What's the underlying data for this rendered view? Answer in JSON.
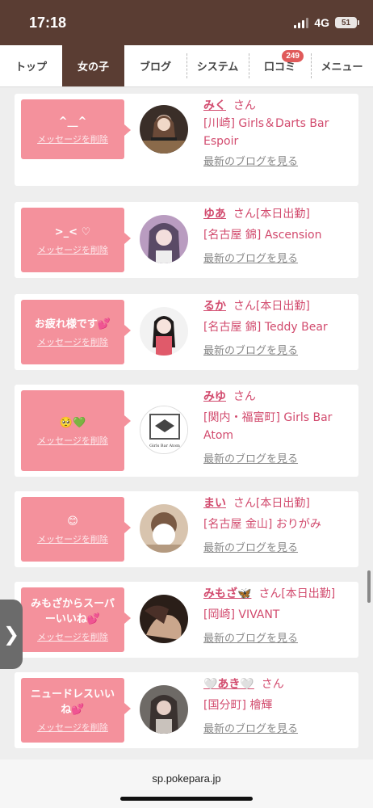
{
  "status_bar": {
    "time": "17:18",
    "network": "4G",
    "battery": "51"
  },
  "nav": {
    "tabs": [
      {
        "label": "トップ",
        "active": false
      },
      {
        "label": "女の子",
        "active": true
      },
      {
        "label": "ブログ",
        "active": false
      },
      {
        "label": "システム",
        "active": false
      },
      {
        "label": "口コミ",
        "active": false,
        "badge": "249"
      },
      {
        "label": "メニュー",
        "active": false
      }
    ]
  },
  "delete_label": "メッセージを削除",
  "san_label": "さん",
  "blog_link_label": "最新のブログを見る",
  "cards": [
    {
      "message": "^__^",
      "name": "みく",
      "status": "",
      "shop": "[川崎] Girls＆Darts Bar Espoir"
    },
    {
      "message": ">_< ♡",
      "name": "ゆあ",
      "status": "[本日出勤]",
      "shop": "[名古屋 錦] Ascension"
    },
    {
      "message": "お疲れ様です💕",
      "name": "るか",
      "status": "[本日出勤]",
      "shop": "[名古屋 錦] Teddy Bear"
    },
    {
      "message": "🥺💚",
      "name": "みゆ",
      "status": "",
      "shop": "[関内・福富町] Girls Bar Atom"
    },
    {
      "message": "😊",
      "name": "まい",
      "status": "[本日出勤]",
      "shop": "[名古屋 金山] おりがみ"
    },
    {
      "message": "みもざからスーパーいいね💕",
      "name": "みもざ🦋",
      "status": "[本日出勤]",
      "shop": "[岡崎] VIVANT"
    },
    {
      "message": "ニュードレスいいね💕",
      "name": "🤍あき🤍",
      "status": "",
      "shop": "[国分町] 檜輝"
    }
  ],
  "avatar_logo_text": "Girls Bar Atom",
  "url": "sp.pokepara.jp",
  "colors": {
    "header": "#5a3d33",
    "accent": "#d24b6e",
    "message_bg": "#f4919c",
    "badge": "#e05a5a"
  }
}
